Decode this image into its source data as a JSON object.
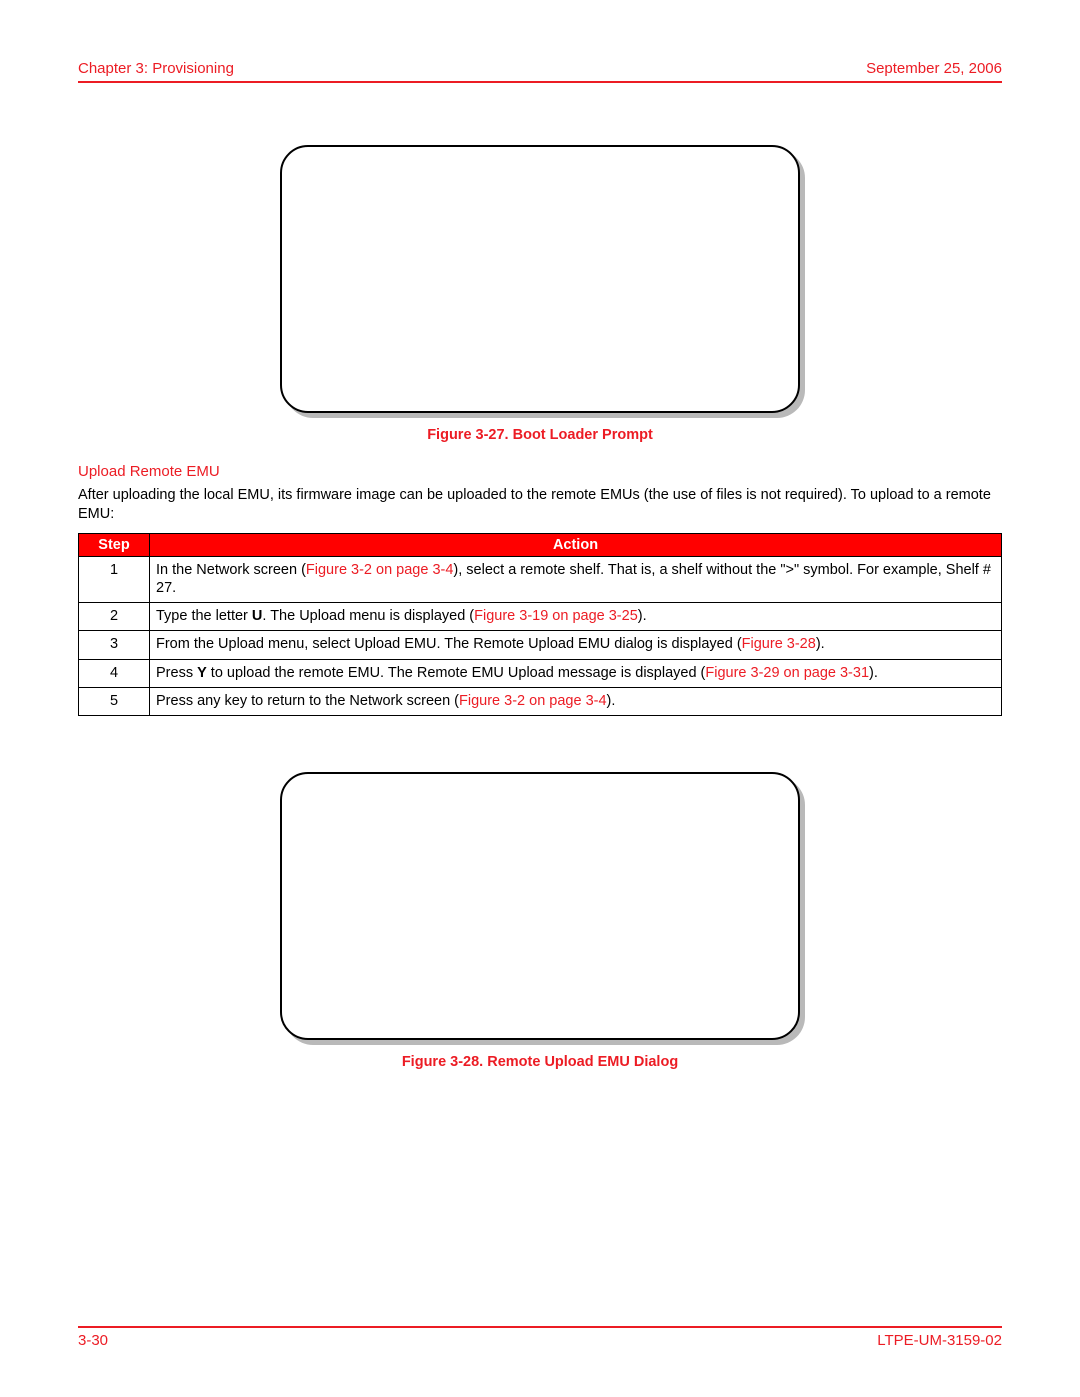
{
  "header": {
    "left": "Chapter 3: Provisioning",
    "right": "September 25, 2006"
  },
  "figure27": {
    "caption": "Figure 3-27. Boot Loader Prompt"
  },
  "section": {
    "heading": "Upload Remote EMU",
    "para": "After uploading the local EMU, its firmware image can be uploaded to the remote EMUs (the use of files is not required). To upload to a remote EMU:"
  },
  "tableHeaders": {
    "step": "Step",
    "action": "Action"
  },
  "steps": {
    "s1": {
      "num": "1",
      "t1": "In the Network screen (",
      "x1": "Figure 3-2 on page 3-4",
      "t2": "), select a remote shelf. That is, a shelf without the \">\" symbol. For example, Shelf # 27."
    },
    "s2": {
      "num": "2",
      "t1": "Type the letter ",
      "b1": "U",
      "t2": ". The Upload menu is displayed (",
      "x1": "Figure 3-19 on page 3-25",
      "t3": ")."
    },
    "s3": {
      "num": "3",
      "t1": "From the Upload menu, select Upload EMU. The Remote Upload EMU dialog is displayed (",
      "x1": "Figure 3-28",
      "t2": ")."
    },
    "s4": {
      "num": "4",
      "t1": "Press ",
      "b1": "Y",
      "t2": " to upload the remote EMU. The Remote EMU Upload message is displayed (",
      "x1": "Figure 3-29 on page 3-31",
      "t3": ")."
    },
    "s5": {
      "num": "5",
      "t1": "Press any key to return to the Network screen (",
      "x1": "Figure 3-2 on page 3-4",
      "t2": ")."
    }
  },
  "figure28": {
    "caption": "Figure 3-28. Remote Upload EMU Dialog"
  },
  "footer": {
    "left": "3-30",
    "right": "LTPE-UM-3159-02"
  }
}
